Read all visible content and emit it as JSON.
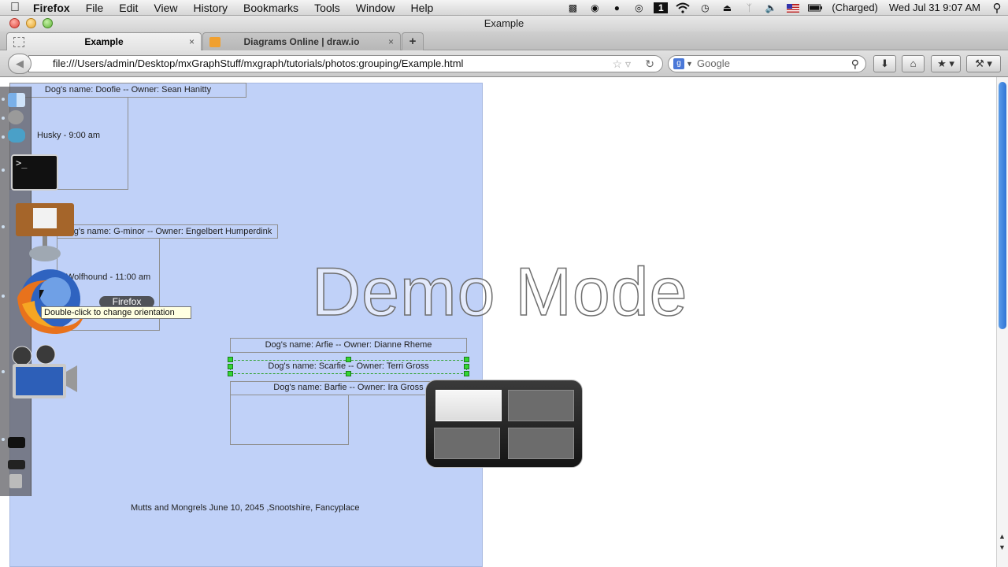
{
  "menubar": {
    "app": "Firefox",
    "items": [
      "File",
      "Edit",
      "View",
      "History",
      "Bookmarks",
      "Tools",
      "Window",
      "Help"
    ],
    "battery": "(Charged)",
    "clock": "Wed Jul 31  9:07 AM"
  },
  "window": {
    "title": "Example"
  },
  "tabs": [
    {
      "label": "Example",
      "close": "×"
    },
    {
      "label": "Diagrams Online | draw.io",
      "close": "×"
    },
    {
      "label": "+"
    }
  ],
  "nav": {
    "url": "file:///Users/admin/Desktop/mxGraphStuff/mxgraph/tutorials/photos:grouping/Example.html",
    "search_placeholder": "Google"
  },
  "diagram": {
    "box1": "Dog's name: Doofie -- Owner: Sean Hanitty",
    "text1": "Husky - 9:00 am",
    "box2": "Dog's name: G-minor -- Owner: Engelbert Humperdink",
    "text2": "Wolfhound - 11:00 am",
    "box3": "Dog's name: Arfie -- Owner: Dianne Rheme",
    "box4": "Dog's name: Scarfie -- Owner: Terri Gross",
    "box5": "Dog's name: Barfie -- Owner: Ira Gross",
    "footer": "Mutts and Mongrels June 10, 2045 ,Snootshire, Fancyplace"
  },
  "overlay": {
    "demo_mode": "Demo Mode"
  },
  "dock": {
    "firefox_label": "Firefox",
    "tooltip": "Double-click to change orientation",
    "terminal_prompt": ">_"
  }
}
